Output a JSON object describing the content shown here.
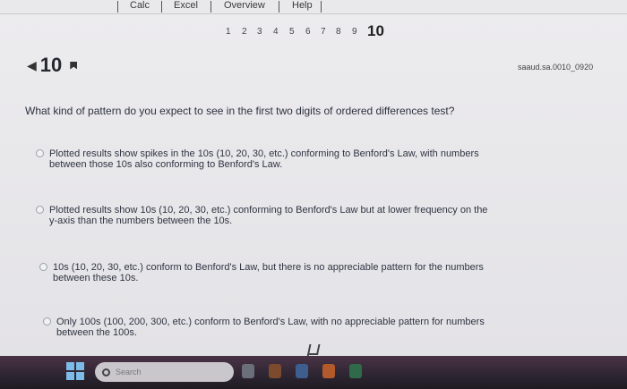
{
  "menubar": {
    "items": [
      "Calc",
      "Excel",
      "Overview",
      "Help"
    ]
  },
  "question_nav": {
    "numbers": [
      "1",
      "2",
      "3",
      "4",
      "5",
      "6",
      "7",
      "8",
      "9"
    ],
    "current": "10"
  },
  "question": {
    "number": "10",
    "id": "saaud.sa.0010_0920",
    "prompt": "What kind of pattern do you expect to see in the first two digits of ordered differences test?",
    "options": [
      "Plotted results show spikes in the 10s (10, 20, 30, etc.) conforming to Benford's Law, with numbers between those 10s also conforming to Benford's Law.",
      "Plotted results show 10s (10, 20, 30, etc.) conforming to Benford's Law but at lower frequency on the y-axis than the numbers between the 10s.",
      "10s (10, 20, 30, etc.) conform to Benford's Law, but there is no appreciable pattern for the numbers between these 10s.",
      "Only 100s (100, 200, 300, etc.) conform to Benford's Law, with no appreciable pattern for numbers between the 100s."
    ]
  },
  "taskbar": {
    "search_placeholder": "Search"
  },
  "colors": {
    "page_bg": "#e8e7ea",
    "taskbar_bg": "#2d2531",
    "start_icon": "#7dbbe8"
  }
}
